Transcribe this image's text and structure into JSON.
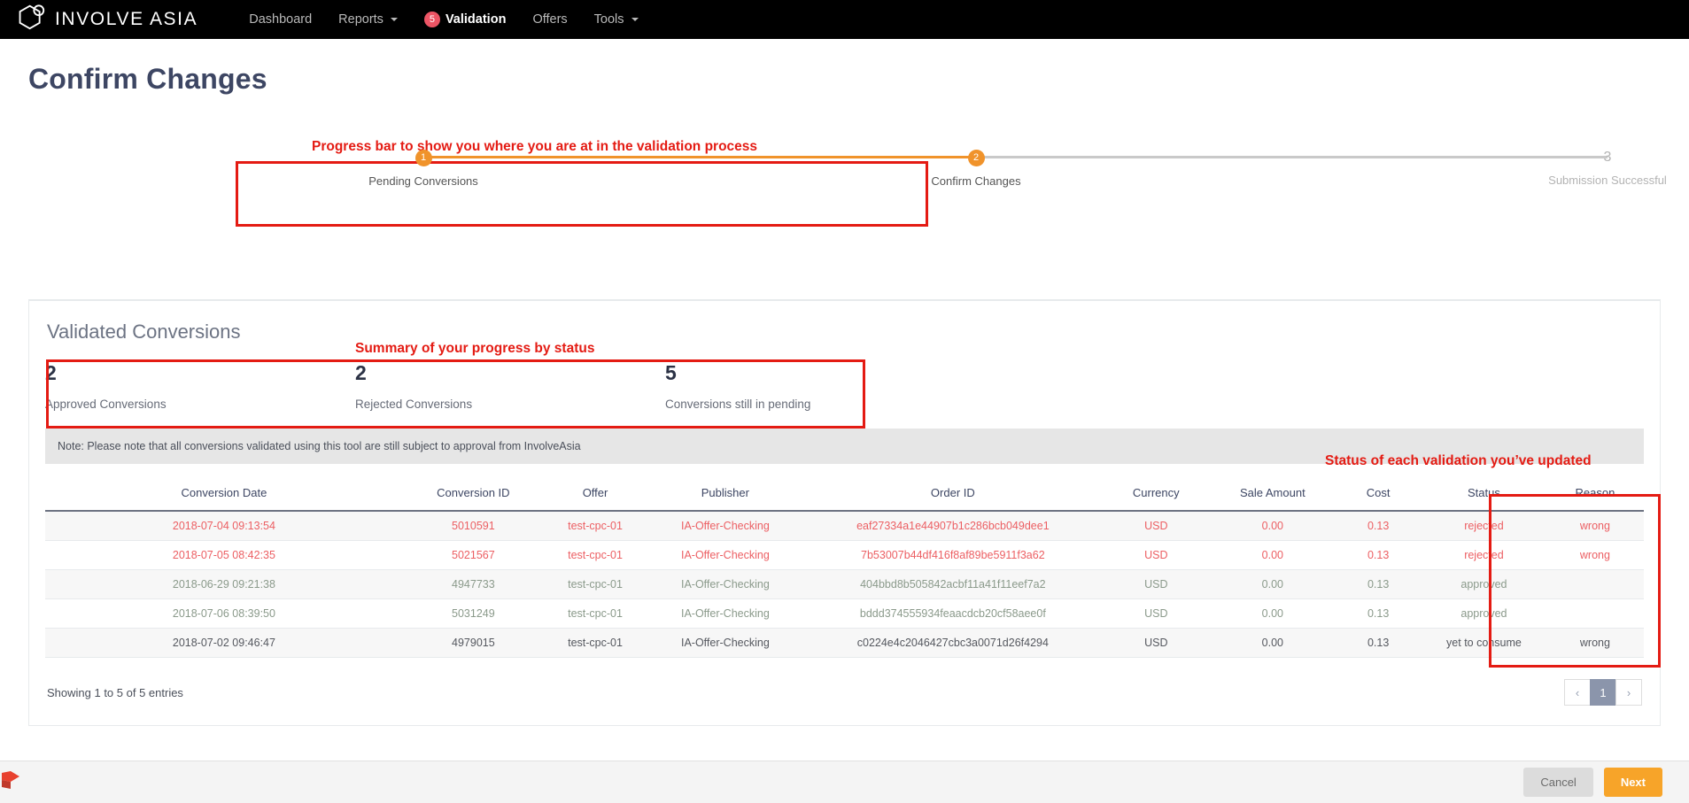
{
  "navbar": {
    "brand": "INVOLVE ASIA",
    "brand_icon": "hexagon-logo-icon",
    "links": [
      {
        "label": "Dashboard",
        "caret": false,
        "active": false,
        "badge": null
      },
      {
        "label": "Reports",
        "caret": true,
        "active": false,
        "badge": null
      },
      {
        "label": "Validation",
        "caret": false,
        "active": true,
        "badge": "5"
      },
      {
        "label": "Offers",
        "caret": false,
        "active": false,
        "badge": null
      },
      {
        "label": "Tools",
        "caret": true,
        "active": false,
        "badge": null
      }
    ],
    "badge_color": "#ed5565"
  },
  "page": {
    "title": "Confirm Changes"
  },
  "annotations": {
    "progress": "Progress bar to show you where you are at in the validation process",
    "summary": "Summary of your progress by status",
    "status": "Status of each validation you’ve updated",
    "color": "#e41b13"
  },
  "wizard": {
    "active_color": "#f0932b",
    "inactive_color": "#b3b3b3",
    "steps": [
      {
        "number": "1",
        "label": "Pending Conversions",
        "state": "complete"
      },
      {
        "number": "2",
        "label": "Confirm Changes",
        "state": "current"
      },
      {
        "number": "3",
        "label": "Submission Successful",
        "state": "upcoming"
      }
    ]
  },
  "card": {
    "title": "Validated Conversions",
    "stats": [
      {
        "value": "2",
        "label": "Approved Conversions"
      },
      {
        "value": "2",
        "label": "Rejected Conversions"
      },
      {
        "value": "5",
        "label": "Conversions still in pending"
      }
    ],
    "note": "Note: Please note that all conversions validated using this tool are still subject to approval from InvolveAsia",
    "table": {
      "columns": [
        "Conversion Date",
        "Conversion ID",
        "Offer",
        "Publisher",
        "Order ID",
        "Currency",
        "Sale Amount",
        "Cost",
        "Status",
        "Reason"
      ],
      "rows": [
        {
          "state": "rejected",
          "cells": [
            "2018-07-04 09:13:54",
            "5010591",
            "test-cpc-01",
            "IA-Offer-Checking",
            "eaf27334a1e44907b1c286bcb049dee1",
            "USD",
            "0.00",
            "0.13",
            "rejected",
            "wrong"
          ]
        },
        {
          "state": "rejected",
          "cells": [
            "2018-07-05 08:42:35",
            "5021567",
            "test-cpc-01",
            "IA-Offer-Checking",
            "7b53007b44df416f8af89be5911f3a62",
            "USD",
            "0.00",
            "0.13",
            "rejected",
            "wrong"
          ]
        },
        {
          "state": "approved",
          "cells": [
            "2018-06-29 09:21:38",
            "4947733",
            "test-cpc-01",
            "IA-Offer-Checking",
            "404bbd8b505842acbf11a41f11eef7a2",
            "USD",
            "0.00",
            "0.13",
            "approved",
            ""
          ]
        },
        {
          "state": "approved",
          "cells": [
            "2018-07-06 08:39:50",
            "5031249",
            "test-cpc-01",
            "IA-Offer-Checking",
            "bddd374555934feaacdcb20cf58aee0f",
            "USD",
            "0.00",
            "0.13",
            "approved",
            ""
          ]
        },
        {
          "state": "pending",
          "cells": [
            "2018-07-02 09:46:47",
            "4979015",
            "test-cpc-01",
            "IA-Offer-Checking",
            "c0224e4c2046427cbc3a0071d26f4294",
            "USD",
            "0.00",
            "0.13",
            "yet to consume",
            "wrong"
          ]
        }
      ]
    },
    "showing": "Showing 1 to 5 of 5 entries",
    "pagination": {
      "prev_icon": "chevron-left-icon",
      "next_icon": "chevron-right-icon",
      "pages": [
        "1"
      ],
      "current": "1"
    }
  },
  "bottom_bar": {
    "cancel_label": "Cancel",
    "next_label": "Next",
    "next_color": "#f7a429"
  }
}
